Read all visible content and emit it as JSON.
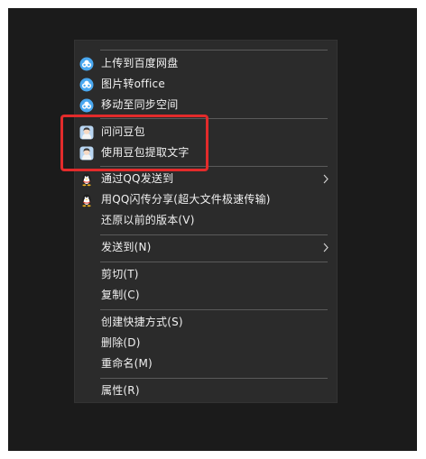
{
  "menu": {
    "groups": [
      {
        "items": [
          {
            "label": "上传到百度网盘",
            "icon": "baidu-cloud-icon"
          },
          {
            "label": "图片转office",
            "icon": "baidu-cloud-icon"
          },
          {
            "label": "移动至同步空间",
            "icon": "baidu-cloud-icon"
          }
        ]
      },
      {
        "items": [
          {
            "label": "问问豆包",
            "icon": "doubao-avatar-icon"
          },
          {
            "label": "使用豆包提取文字",
            "icon": "doubao-avatar-icon"
          }
        ]
      },
      {
        "items": [
          {
            "label": "通过QQ发送到",
            "icon": "qq-penguin-icon",
            "submenu": true
          },
          {
            "label": "用QQ闪传分享(超大文件极速传输)",
            "icon": "qq-penguin-icon"
          },
          {
            "label": "还原以前的版本(V)",
            "icon": ""
          }
        ]
      },
      {
        "items": [
          {
            "label": "发送到(N)",
            "icon": "",
            "submenu": true
          }
        ]
      },
      {
        "items": [
          {
            "label": "剪切(T)",
            "icon": ""
          },
          {
            "label": "复制(C)",
            "icon": ""
          }
        ]
      },
      {
        "items": [
          {
            "label": "创建快捷方式(S)",
            "icon": ""
          },
          {
            "label": "删除(D)",
            "icon": ""
          },
          {
            "label": "重命名(M)",
            "icon": ""
          }
        ]
      },
      {
        "items": [
          {
            "label": "属性(R)",
            "icon": ""
          }
        ]
      }
    ]
  },
  "colors": {
    "menu_bg": "#2b2b2b",
    "text": "#f0f0f0",
    "separator": "#5a5a5a",
    "highlight_border": "#e32b2b",
    "baidu_blue": "#4aa8f0"
  }
}
